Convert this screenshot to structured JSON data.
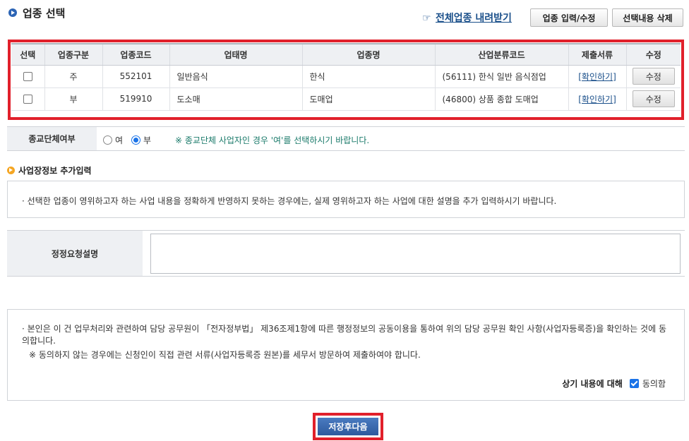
{
  "header": {
    "title": "업종 선택",
    "download_link": "전체업종 내려받기",
    "edit_button": "업종 입력/수정",
    "delete_button": "선택내용 삭제"
  },
  "table": {
    "columns": [
      "선택",
      "업종구분",
      "업종코드",
      "업태명",
      "업종명",
      "산업분류코드",
      "제출서류",
      "수정"
    ],
    "rows": [
      {
        "type": "주",
        "code": "552101",
        "business": "일반음식",
        "industry": "한식",
        "class_code": "(56111) 한식 일반 음식점업",
        "docs": "[확인하기]",
        "edit": "수정"
      },
      {
        "type": "부",
        "code": "519910",
        "business": "도소매",
        "industry": "도매업",
        "class_code": "(46800) 상품 종합 도매업",
        "docs": "[확인하기]",
        "edit": "수정"
      }
    ]
  },
  "religion": {
    "label": "종교단체여부",
    "options": [
      "여",
      "부"
    ],
    "selected": "부",
    "notice": "※ 종교단체 사업자인 경우 '여'를 선택하시기 바랍니다."
  },
  "extra_info": {
    "title": "사업장정보 추가입력",
    "info": "· 선택한 업종이 영위하고자 하는 사업 내용을 정확하게 반영하지 못하는 경우에는, 실제 영위하고자 하는 사업에 대한 설명을 추가 입력하시기 바랍니다."
  },
  "request": {
    "label": "정정요청설명",
    "value": ""
  },
  "agreement": {
    "para1": "· 본인은 이 건 업무처리와 관련하여 담당 공무원이 「전자정부법」 제36조제1항에 따른 행정정보의 공동이용을 통하여 위의 담당 공무원 확인 사항(사업자등록증)을 확인하는 것에 동의합니다.",
    "para2": "※  동의하지 않는 경우에는 신청인이 직접 관련 서류(사업자등록증 원본)를 세무서 방문하여 제출하여야 합니다.",
    "label": "상기 내용에 대해",
    "checkbox_text": "동의함"
  },
  "save_button": "저장후다음"
}
